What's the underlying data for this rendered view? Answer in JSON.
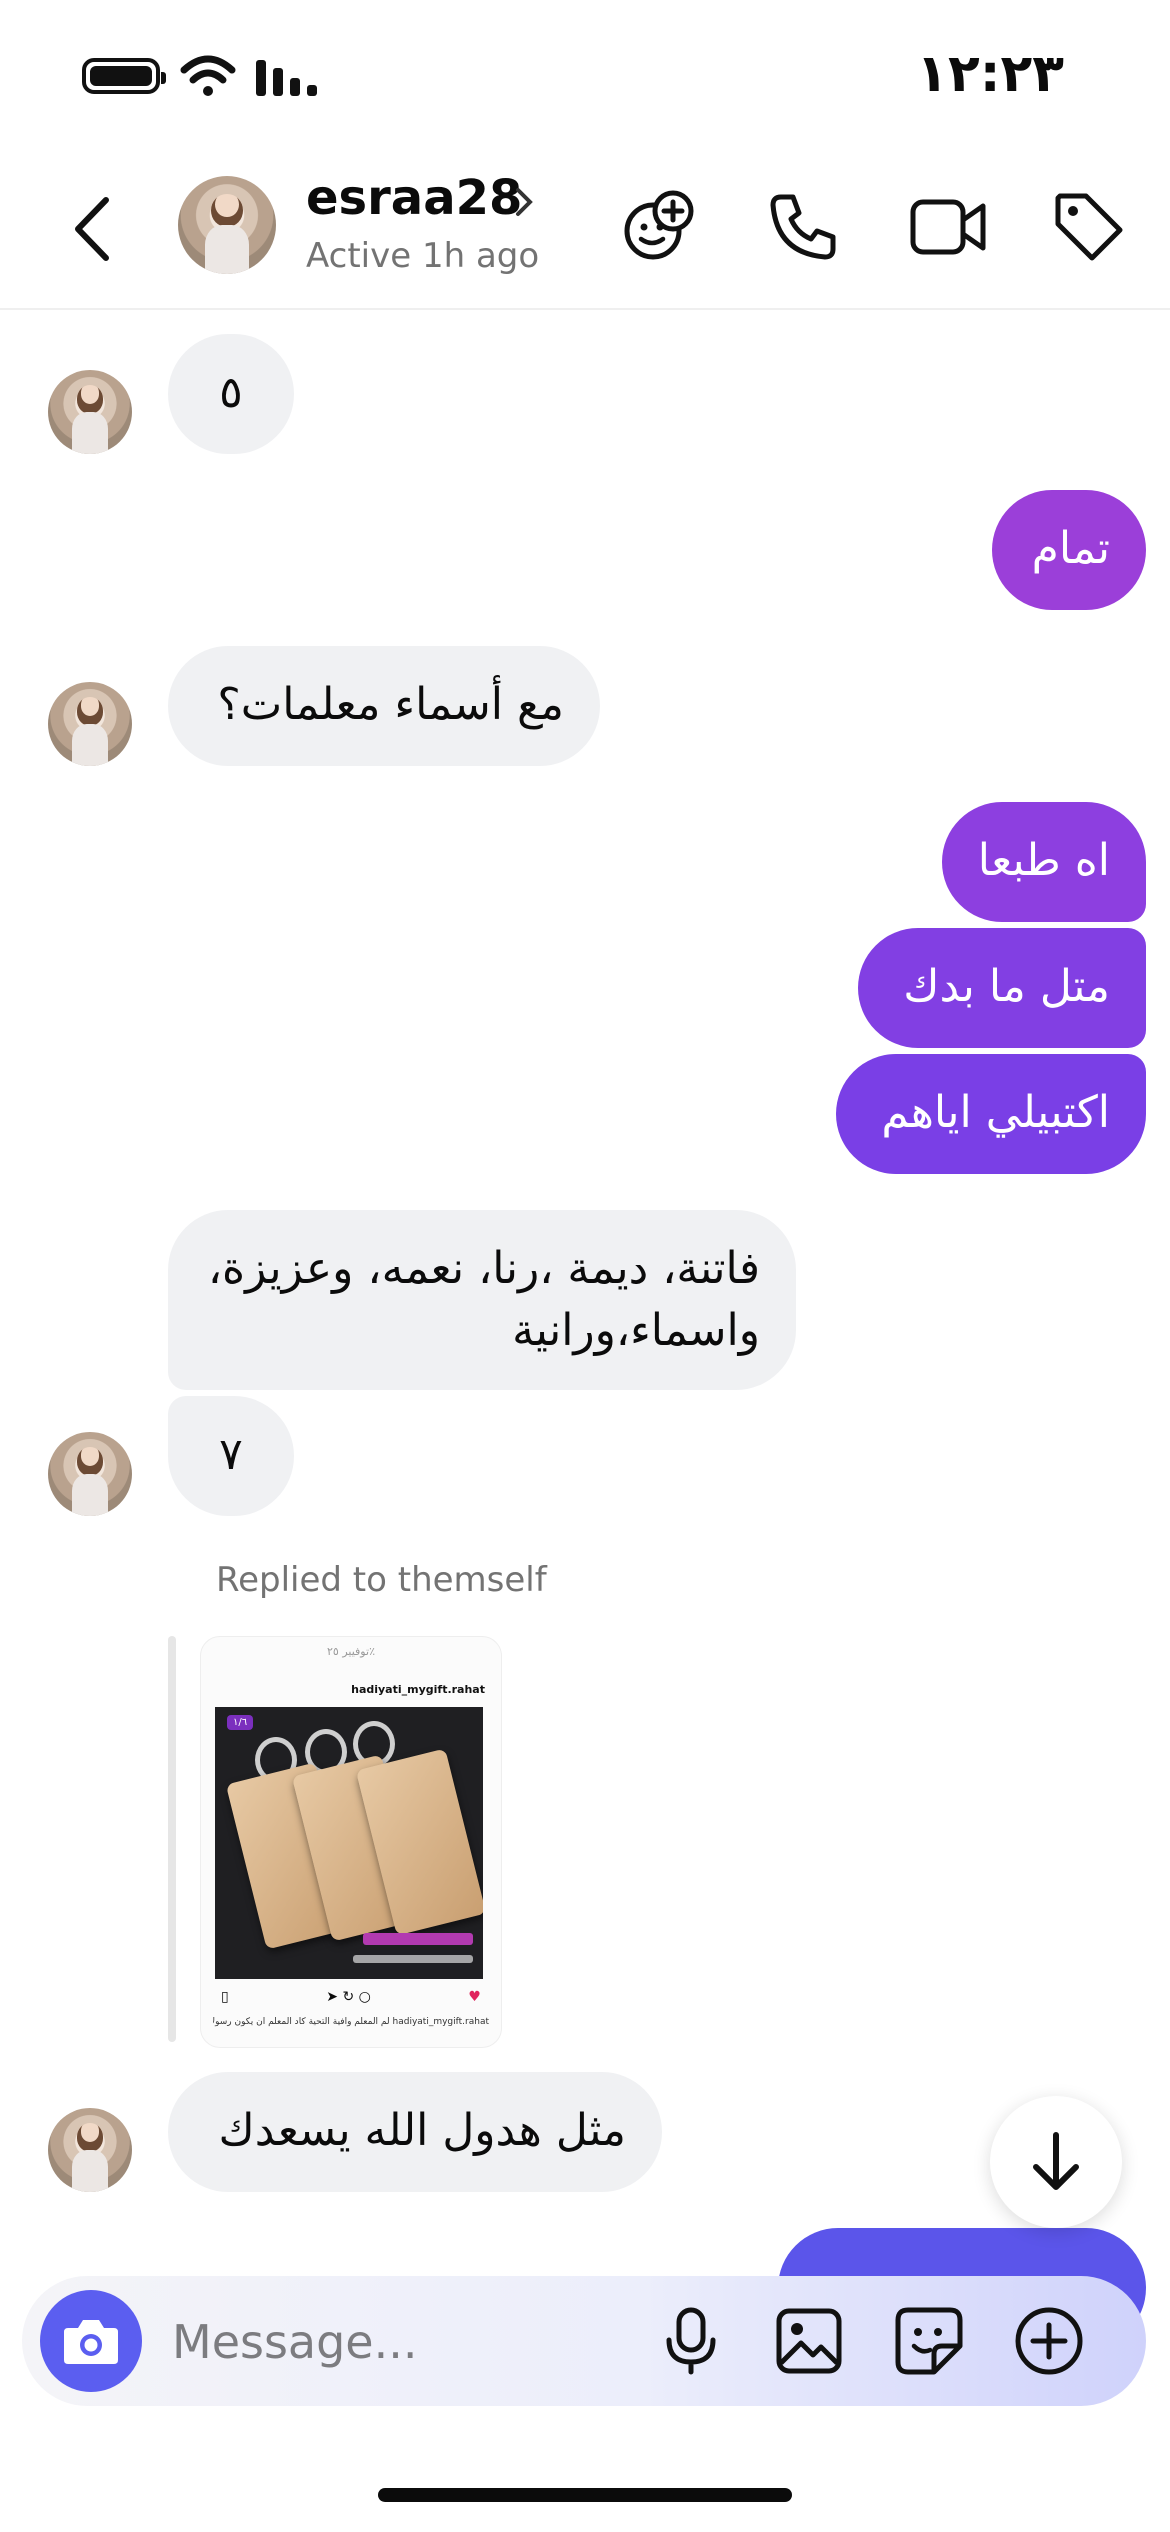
{
  "status_bar": {
    "time": "١٢:٢٣"
  },
  "header": {
    "username": "esraa28",
    "presence": "Active 1h ago",
    "icons": [
      "back-icon",
      "add-effect-icon",
      "phone-icon",
      "video-icon",
      "tag-icon"
    ]
  },
  "messages": [
    {
      "direction": "in",
      "text": "٥"
    },
    {
      "direction": "out",
      "text": "تمام"
    },
    {
      "direction": "in",
      "text": "مع أسماء معلمات؟"
    },
    {
      "direction": "out",
      "text": "اه طبعا"
    },
    {
      "direction": "out",
      "text": "متل ما بدك"
    },
    {
      "direction": "out",
      "text": "اكتبيلي اياهم"
    },
    {
      "direction": "in",
      "lines": [
        "فاتنة، ديمة ،رنا، نعمه، وعزيزة،",
        "واسماء،ورانية"
      ]
    },
    {
      "direction": "in",
      "text": "٧"
    },
    {
      "direction": "in",
      "text": "مثل هدول الله يسعدك"
    }
  ],
  "reply": {
    "label": "Replied to themself",
    "post": {
      "header_text": "توفيير ٢٥٪",
      "account": "hadiyati_mygift.rahat",
      "page_badge": "١/٦",
      "caption": "hadiyati_mygift.rahat لم المعلم وافية التحية كاد المعلم أن يكون رسولا"
    }
  },
  "composer": {
    "placeholder": "Message...",
    "icons": [
      "camera-icon",
      "microphone-icon",
      "gallery-icon",
      "sticker-icon",
      "add-icon"
    ]
  },
  "colors": {
    "outgoing_top": "#9b3fd9",
    "outgoing_mid": "#7e3fe4",
    "outgoing_bottom": "#5b55ea",
    "incoming": "#f0f1f3",
    "accent": "#5b5ef0"
  }
}
